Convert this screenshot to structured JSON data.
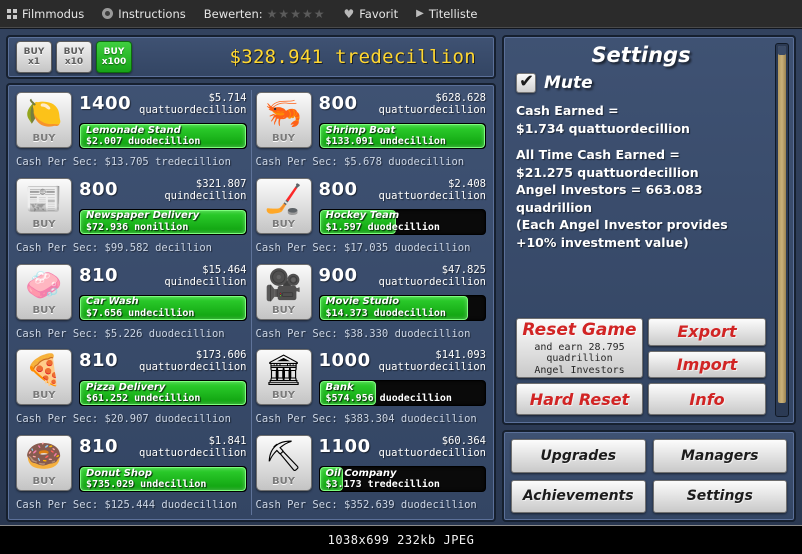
{
  "viewer_bar": {
    "items": [
      {
        "icon": "grid-icon",
        "label": "Filmmodus"
      },
      {
        "icon": "info-circle-icon",
        "label": "Instructions"
      },
      {
        "icon": "none",
        "label": "Bewerten:"
      },
      {
        "icon": "stars-icon",
        "label": "★★★★★"
      },
      {
        "icon": "heart-icon",
        "label": "Favorit"
      },
      {
        "icon": "play-icon",
        "label": "Titelliste"
      }
    ]
  },
  "toolbar": {
    "buy_buttons": [
      {
        "top": "BUY",
        "bottom": "x1",
        "active": false
      },
      {
        "top": "BUY",
        "bottom": "x10",
        "active": false
      },
      {
        "top": "BUY",
        "bottom": "x100",
        "active": true
      }
    ],
    "cash_total": "$328.941 tredecillion"
  },
  "businesses_left": [
    {
      "glyph": "🍋",
      "icon_name": "lemon-icon",
      "buy_label": "BUY",
      "count": "1400",
      "price": "$5.714",
      "price_unit": "quattuordecillion",
      "name": "Lemonade Stand",
      "revenue": "$2.007  duodecillion",
      "progress": 100,
      "cps": "Cash Per Sec: $13.705 tredecillion"
    },
    {
      "glyph": "📰",
      "icon_name": "newspaper-icon",
      "buy_label": "BUY",
      "count": "800",
      "price": "$321.807",
      "price_unit": "quindecillion",
      "name": "Newspaper Delivery",
      "revenue": "$72.936  nonillion",
      "progress": 100,
      "cps": "Cash Per Sec: $99.582 decillion"
    },
    {
      "glyph": "🧼",
      "icon_name": "car-wash-icon",
      "buy_label": "BUY",
      "count": "810",
      "price": "$15.464",
      "price_unit": "quindecillion",
      "name": "Car Wash",
      "revenue": "$7.656  undecillion",
      "progress": 100,
      "cps": "Cash Per Sec: $5.226 duodecillion"
    },
    {
      "glyph": "🍕",
      "icon_name": "pizza-icon",
      "buy_label": "BUY",
      "count": "810",
      "price": "$173.606",
      "price_unit": "quattuordecillion",
      "name": "Pizza Delivery",
      "revenue": "$61.252  undecillion",
      "progress": 100,
      "cps": "Cash Per Sec: $20.907 duodecillion"
    },
    {
      "glyph": "🍩",
      "icon_name": "donut-icon",
      "buy_label": "BUY",
      "count": "810",
      "price": "$1.841",
      "price_unit": "quattuordecillion",
      "name": "Donut Shop",
      "revenue": "$735.029  undecillion",
      "progress": 100,
      "cps": "Cash Per Sec: $125.444 duodecillion"
    }
  ],
  "businesses_right": [
    {
      "glyph": "🦐",
      "icon_name": "shrimp-icon",
      "buy_label": "BUY",
      "count": "800",
      "price": "$628.628",
      "price_unit": "quattuordecillion",
      "name": "Shrimp Boat",
      "revenue": "$133.091  undecillion",
      "progress": 100,
      "cps": "Cash Per Sec: $5.678 duodecillion"
    },
    {
      "glyph": "🏒",
      "icon_name": "hockey-icon",
      "buy_label": "BUY",
      "count": "800",
      "price": "$2.408",
      "price_unit": "quattuordecillion",
      "name": "Hockey Team",
      "revenue": "$1.597  duodecillion",
      "progress": 46,
      "cps": "Cash Per Sec: $17.035 duodecillion"
    },
    {
      "glyph": "🎥",
      "icon_name": "movie-camera-icon",
      "buy_label": "BUY",
      "count": "900",
      "price": "$47.825",
      "price_unit": "quattuordecillion",
      "name": "Movie Studio",
      "revenue": "$14.373  duodecillion",
      "progress": 90,
      "cps": "Cash Per Sec: $38.330 duodecillion"
    },
    {
      "glyph": "🏛",
      "icon_name": "bank-icon",
      "buy_label": "BUY",
      "count": "1000",
      "price": "$141.093",
      "price_unit": "quattuordecillion",
      "name": "Bank",
      "revenue": "$574.956  duodecillion",
      "progress": 34,
      "cps": "Cash Per Sec: $383.304 duodecillion"
    },
    {
      "glyph": "⛏",
      "icon_name": "oil-derrick-icon",
      "buy_label": "BUY",
      "count": "1100",
      "price": "$60.364",
      "price_unit": "quattuordecillion",
      "name": "Oil Company",
      "revenue": "$3.173  tredecillion",
      "progress": 14,
      "cps": "Cash Per Sec: $352.639 duodecillion"
    }
  ],
  "settings": {
    "title": "Settings",
    "mute_label": "Mute",
    "mute_checked": true,
    "stats": [
      "Cash Earned =",
      "$1.734 quattuordecillion",
      "",
      "All Time Cash Earned =",
      "$21.275 quattuordecillion",
      "Angel Investors = 663.083",
      "quadrillion",
      "(Each Angel Investor provides",
      "+10% investment value)"
    ],
    "reset_game_label": "Reset Game",
    "reset_game_sub": "and earn 28.795\nquadrillion\nAngel Investors",
    "export_label": "Export",
    "import_label": "Import",
    "hard_reset_label": "Hard Reset",
    "info_label": "Info"
  },
  "menu": {
    "buttons": [
      "Upgrades",
      "Managers",
      "Achievements",
      "Settings"
    ]
  },
  "status_bar": {
    "text": "1038x699 232kb JPEG"
  },
  "colors": {
    "accent_green": "#17a317",
    "cash_yellow": "#ffd731",
    "reset_red": "#d12424",
    "panel_blue": "#3f5273"
  }
}
